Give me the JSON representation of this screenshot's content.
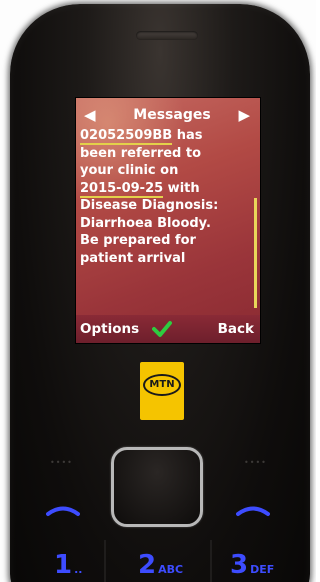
{
  "screen": {
    "title": "Messages",
    "nav_left_glyph": "◀",
    "nav_right_glyph": "▶",
    "message": {
      "id": "02052509BB",
      "line1_rest": " has",
      "line2": "been referred to",
      "line3": "your clinic on",
      "date": "2015-09-25",
      "line4_rest": " with",
      "line5": "Disease Diagnosis:",
      "line6": "Diarrhoea Bloody.",
      "line7": "Be prepared for",
      "line8": "patient arrival"
    },
    "softkeys": {
      "left": "Options",
      "right": "Back"
    }
  },
  "branding": {
    "logo_text": "MTN"
  },
  "keypad": {
    "key1_num": "1",
    "key1_sub": "..",
    "key2_num": "2",
    "key2_sub": "ABC",
    "key3_num": "3",
    "key3_sub": "DEF"
  },
  "colors": {
    "screen_bg": "#b24a45",
    "softkey_bar": "#7a2430",
    "underline": "#e3d14a",
    "check": "#2ecc40",
    "mtn_yellow": "#f5c400",
    "key_blue": "#3d4cff"
  },
  "icons": {
    "check": "check-mark-icon",
    "left_call": "call-answer-icon",
    "right_call": "call-end-icon"
  }
}
